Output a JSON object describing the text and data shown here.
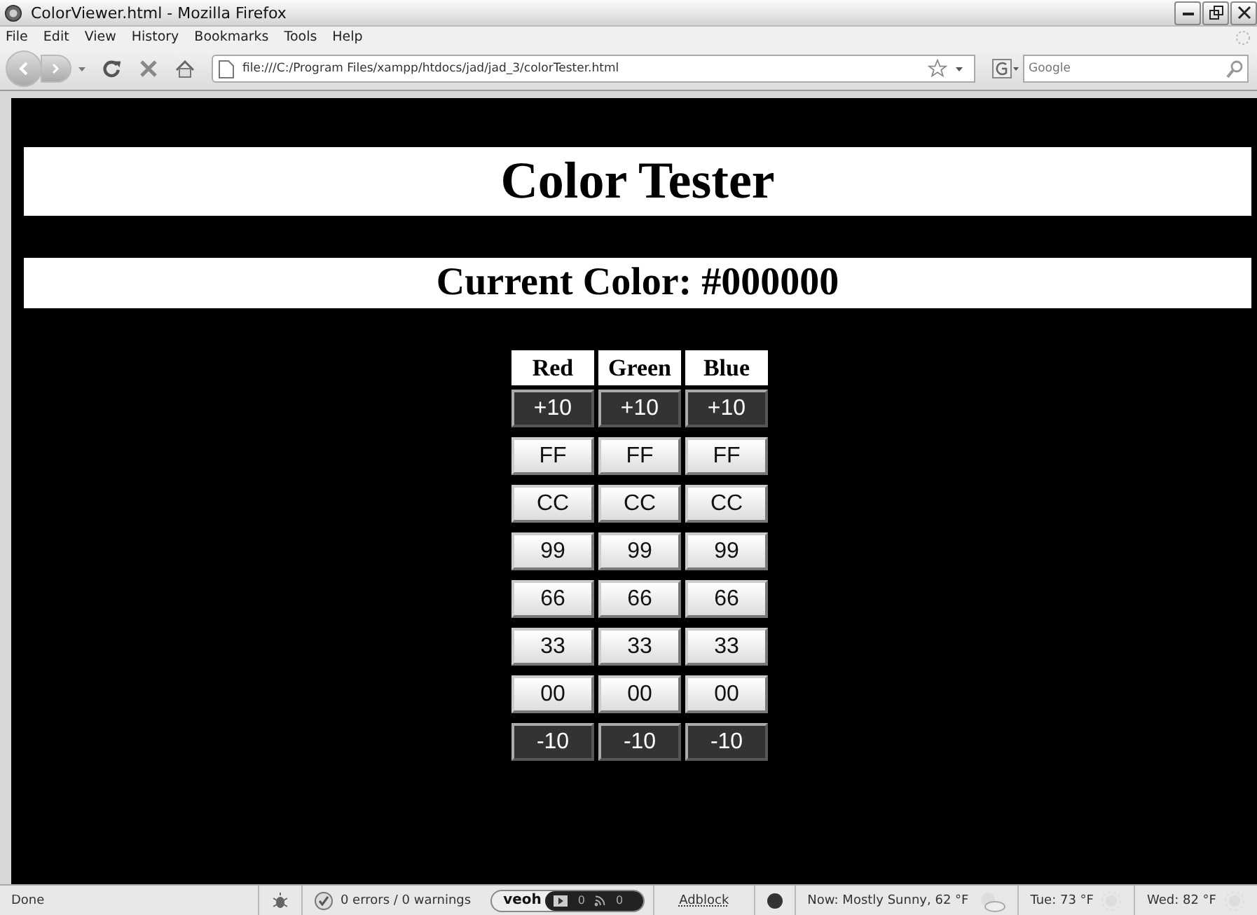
{
  "window": {
    "title": "ColorViewer.html - Mozilla Firefox"
  },
  "menu": [
    "File",
    "Edit",
    "View",
    "History",
    "Bookmarks",
    "Tools",
    "Help"
  ],
  "address": {
    "value": "file:///C:/Program Files/xampp/htdocs/jad/jad_3/colorTester.html"
  },
  "search": {
    "placeholder": "Google"
  },
  "page": {
    "title": "Color Tester",
    "current_color": "Current Color: #000000",
    "table": {
      "columns": [
        "Red",
        "Green",
        "Blue"
      ],
      "rows": [
        {
          "kind": "step",
          "buttons": [
            "+10",
            "+10",
            "+10"
          ]
        },
        {
          "kind": "value",
          "buttons": [
            "FF",
            "FF",
            "FF"
          ]
        },
        {
          "kind": "value",
          "buttons": [
            "CC",
            "CC",
            "CC"
          ]
        },
        {
          "kind": "value",
          "buttons": [
            "99",
            "99",
            "99"
          ]
        },
        {
          "kind": "value",
          "buttons": [
            "66",
            "66",
            "66"
          ]
        },
        {
          "kind": "value",
          "buttons": [
            "33",
            "33",
            "33"
          ]
        },
        {
          "kind": "value",
          "buttons": [
            "00",
            "00",
            "00"
          ]
        },
        {
          "kind": "step",
          "buttons": [
            "-10",
            "-10",
            "-10"
          ]
        }
      ]
    }
  },
  "status_bar": {
    "status": "Done",
    "errors": "0 errors / 0 warnings",
    "veoh": {
      "logo": "veoh",
      "videos": "0",
      "feeds": "0"
    },
    "adblock": "Adblock",
    "weather_now": "Now: Mostly Sunny, 62 °F",
    "tue": "Tue: 73 °F",
    "wed": "Wed: 82 °F"
  }
}
